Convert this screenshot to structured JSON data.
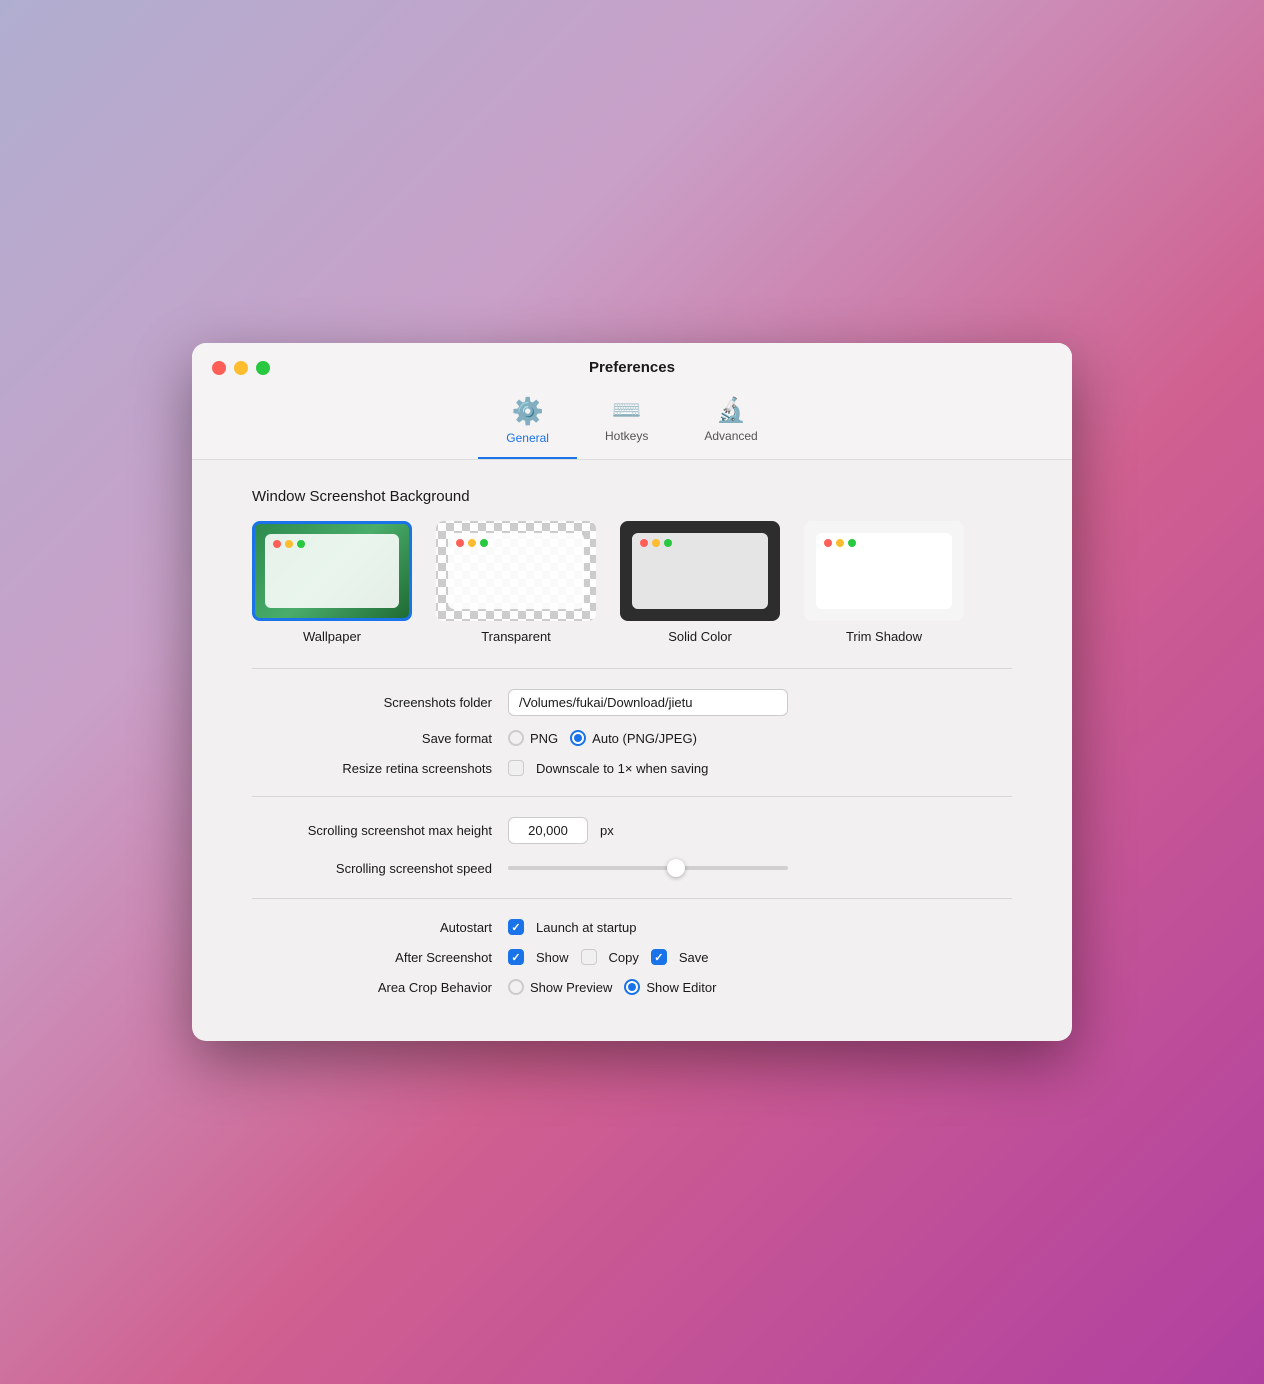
{
  "window": {
    "title": "Preferences"
  },
  "trafficLights": {
    "close": "close",
    "minimize": "minimize",
    "maximize": "maximize"
  },
  "toolbar": {
    "items": [
      {
        "id": "general",
        "label": "General",
        "icon": "⚙",
        "active": true
      },
      {
        "id": "hotkeys",
        "label": "Hotkeys",
        "icon": "⌨",
        "active": false
      },
      {
        "id": "advanced",
        "label": "Advanced",
        "icon": "🔬",
        "active": false
      }
    ]
  },
  "bgSection": {
    "title": "Window Screenshot Background",
    "options": [
      {
        "id": "wallpaper",
        "label": "Wallpaper",
        "selected": true
      },
      {
        "id": "transparent",
        "label": "Transparent",
        "selected": false
      },
      {
        "id": "solid",
        "label": "Solid Color",
        "selected": false
      },
      {
        "id": "trim",
        "label": "Trim Shadow",
        "selected": false
      }
    ]
  },
  "form": {
    "screenshotsFolder": {
      "label": "Screenshots folder",
      "value": "/Volumes/fukai/Download/jietu"
    },
    "saveFormat": {
      "label": "Save format",
      "options": [
        {
          "id": "png",
          "label": "PNG",
          "checked": false
        },
        {
          "id": "auto",
          "label": "Auto (PNG/JPEG)",
          "checked": true
        }
      ]
    },
    "resizeRetina": {
      "label": "Resize retina screenshots",
      "checkboxLabel": "Downscale to 1× when saving",
      "checked": false
    },
    "scrollingMaxHeight": {
      "label": "Scrolling screenshot max height",
      "value": "20,000",
      "unit": "px"
    },
    "scrollingSpeed": {
      "label": "Scrolling screenshot speed",
      "sliderValue": 60
    },
    "autostart": {
      "label": "Autostart",
      "checkboxLabel": "Launch at startup",
      "checked": true
    },
    "afterScreenshot": {
      "label": "After Screenshot",
      "options": [
        {
          "id": "show",
          "label": "Show",
          "checked": true
        },
        {
          "id": "copy",
          "label": "Copy",
          "checked": false
        },
        {
          "id": "save",
          "label": "Save",
          "checked": true
        }
      ]
    },
    "areaCropBehavior": {
      "label": "Area Crop Behavior",
      "options": [
        {
          "id": "preview",
          "label": "Show Preview",
          "checked": false
        },
        {
          "id": "editor",
          "label": "Show Editor",
          "checked": true
        }
      ]
    }
  }
}
